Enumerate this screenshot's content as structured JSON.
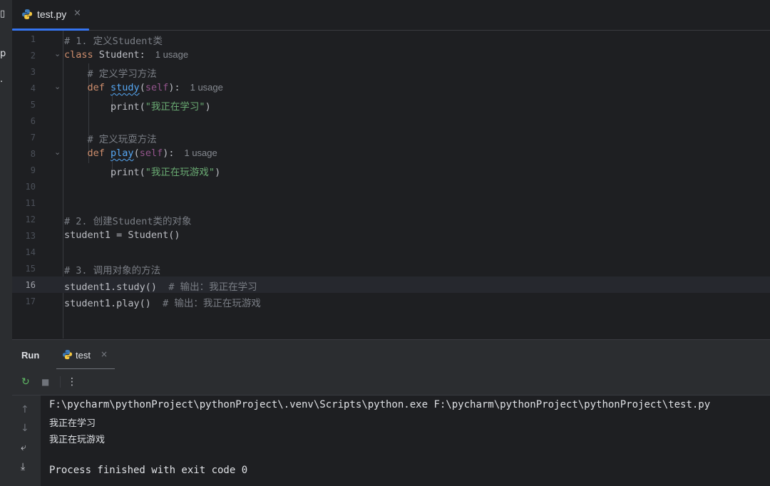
{
  "left_strip": {
    "glyphs": [
      "▯",
      "p",
      "."
    ]
  },
  "editor_tab": {
    "file_name": "test.py",
    "close": "×",
    "icon": "python-icon"
  },
  "code_lines": [
    {
      "n": "1",
      "parts": [
        {
          "t": "# 1. 定义Student类",
          "c": "cm"
        }
      ]
    },
    {
      "n": "2",
      "parts": [
        {
          "t": "class",
          "c": "kw"
        },
        {
          "t": " Student:"
        }
      ],
      "hint": "1 usage"
    },
    {
      "n": "3",
      "parts": [
        {
          "t": "    "
        },
        {
          "t": "# 定义学习方法",
          "c": "cm"
        }
      ]
    },
    {
      "n": "4",
      "parts": [
        {
          "t": "    "
        },
        {
          "t": "def",
          "c": "kw"
        },
        {
          "t": " "
        },
        {
          "t": "study",
          "c": "fn"
        },
        {
          "t": "("
        },
        {
          "t": "self",
          "c": "slf"
        },
        {
          "t": "):"
        }
      ],
      "hint": "1 usage"
    },
    {
      "n": "5",
      "parts": [
        {
          "t": "        print("
        },
        {
          "t": "\"我正在学习\"",
          "c": "str"
        },
        {
          "t": ")"
        }
      ]
    },
    {
      "n": "6",
      "parts": []
    },
    {
      "n": "7",
      "parts": [
        {
          "t": "    "
        },
        {
          "t": "# 定义玩耍方法",
          "c": "cm"
        }
      ]
    },
    {
      "n": "8",
      "parts": [
        {
          "t": "    "
        },
        {
          "t": "def",
          "c": "kw"
        },
        {
          "t": " "
        },
        {
          "t": "play",
          "c": "fn"
        },
        {
          "t": "("
        },
        {
          "t": "self",
          "c": "slf"
        },
        {
          "t": "):"
        }
      ],
      "hint": "1 usage"
    },
    {
      "n": "9",
      "parts": [
        {
          "t": "        print("
        },
        {
          "t": "\"我正在玩游戏\"",
          "c": "str"
        },
        {
          "t": ")"
        }
      ]
    },
    {
      "n": "10",
      "parts": []
    },
    {
      "n": "11",
      "parts": []
    },
    {
      "n": "12",
      "parts": [
        {
          "t": "# 2. 创建Student类的对象",
          "c": "cm"
        }
      ]
    },
    {
      "n": "13",
      "parts": [
        {
          "t": "student1 = Student()"
        }
      ]
    },
    {
      "n": "14",
      "parts": []
    },
    {
      "n": "15",
      "parts": [
        {
          "t": "# 3. 调用对象的方法",
          "c": "cm"
        }
      ]
    },
    {
      "n": "16",
      "parts": [
        {
          "t": "student1.study()  "
        },
        {
          "t": "# 输出：我正在学习",
          "c": "cm"
        }
      ],
      "current": true
    },
    {
      "n": "17",
      "parts": [
        {
          "t": "student1.play()  "
        },
        {
          "t": "# 输出：我正在玩游戏",
          "c": "cm"
        }
      ]
    }
  ],
  "run_panel": {
    "title": "Run",
    "tab_name": "test",
    "close": "×",
    "toolbar": {
      "rerun": "↻",
      "stop": "■",
      "more": "⋮"
    },
    "side": {
      "up": "↑",
      "down": "↓",
      "wrap": "⤶",
      "scroll_end": "⤓"
    },
    "console_lines": [
      "F:\\pycharm\\pythonProject\\pythonProject\\.venv\\Scripts\\python.exe F:\\pycharm\\pythonProject\\pythonProject\\test.py",
      "我正在学习",
      "我正在玩游戏",
      "",
      "Process finished with exit code 0"
    ]
  },
  "colors": {
    "accent": "#3574f0",
    "keyword": "#cf8e6d",
    "function": "#56a8f5",
    "self": "#94558d",
    "string": "#6aab73",
    "comment": "#7a7e85"
  }
}
